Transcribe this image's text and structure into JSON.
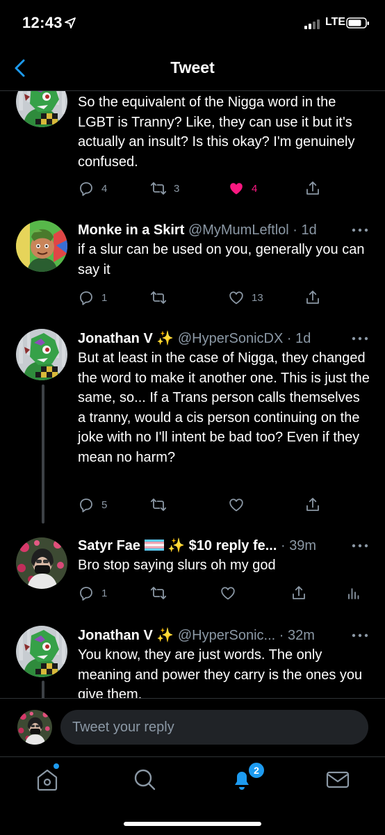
{
  "status_bar": {
    "time": "12:43",
    "network": "LTE"
  },
  "nav": {
    "title": "Tweet"
  },
  "tweets": [
    {
      "body": "So the equivalent of the Nigga word in the LGBT is Tranny? Like, they can use it but it's actually an insult? Is this okay? I'm genuinely confused.",
      "replies": "4",
      "retweets": "3",
      "likes": "4",
      "liked": true
    },
    {
      "name": "Monke in a Skirt",
      "handle": "@MyMumLeftlol",
      "time": "1d",
      "body": "if a slur can be used on you, generally you can say it",
      "replies": "1",
      "retweets": "",
      "likes": "13"
    },
    {
      "name": "Jonathan V",
      "emoji": "✨",
      "handle": "@HyperSonicDX",
      "time": "1d",
      "body": "But at least in the case of Nigga, they changed the word to make it another one. This is just the same, so... If a Trans person calls themselves a tranny, would a cis person continuing on the joke with no I'll intent be bad too? Even if they mean no harm?",
      "replies": "5",
      "retweets": "",
      "likes": ""
    },
    {
      "name": "Satyr Fae",
      "emoji": "✨",
      "name_suffix": "$10 reply fe...",
      "handle": "",
      "time": "39m",
      "body": "Bro stop saying slurs oh my god",
      "replies": "1",
      "retweets": "",
      "likes": ""
    },
    {
      "name": "Jonathan V",
      "emoji": "✨",
      "handle": "@HyperSonic...",
      "time": "32m",
      "body": "You know, they are just words. The only meaning and power they carry is the ones you give them."
    }
  ],
  "reply_bar": {
    "placeholder": "Tweet your reply"
  },
  "tab_bar": {
    "notifications_badge": "2"
  },
  "colors": {
    "like": "#f91880",
    "accent": "#1d9bf0",
    "muted": "#8b98a5"
  }
}
